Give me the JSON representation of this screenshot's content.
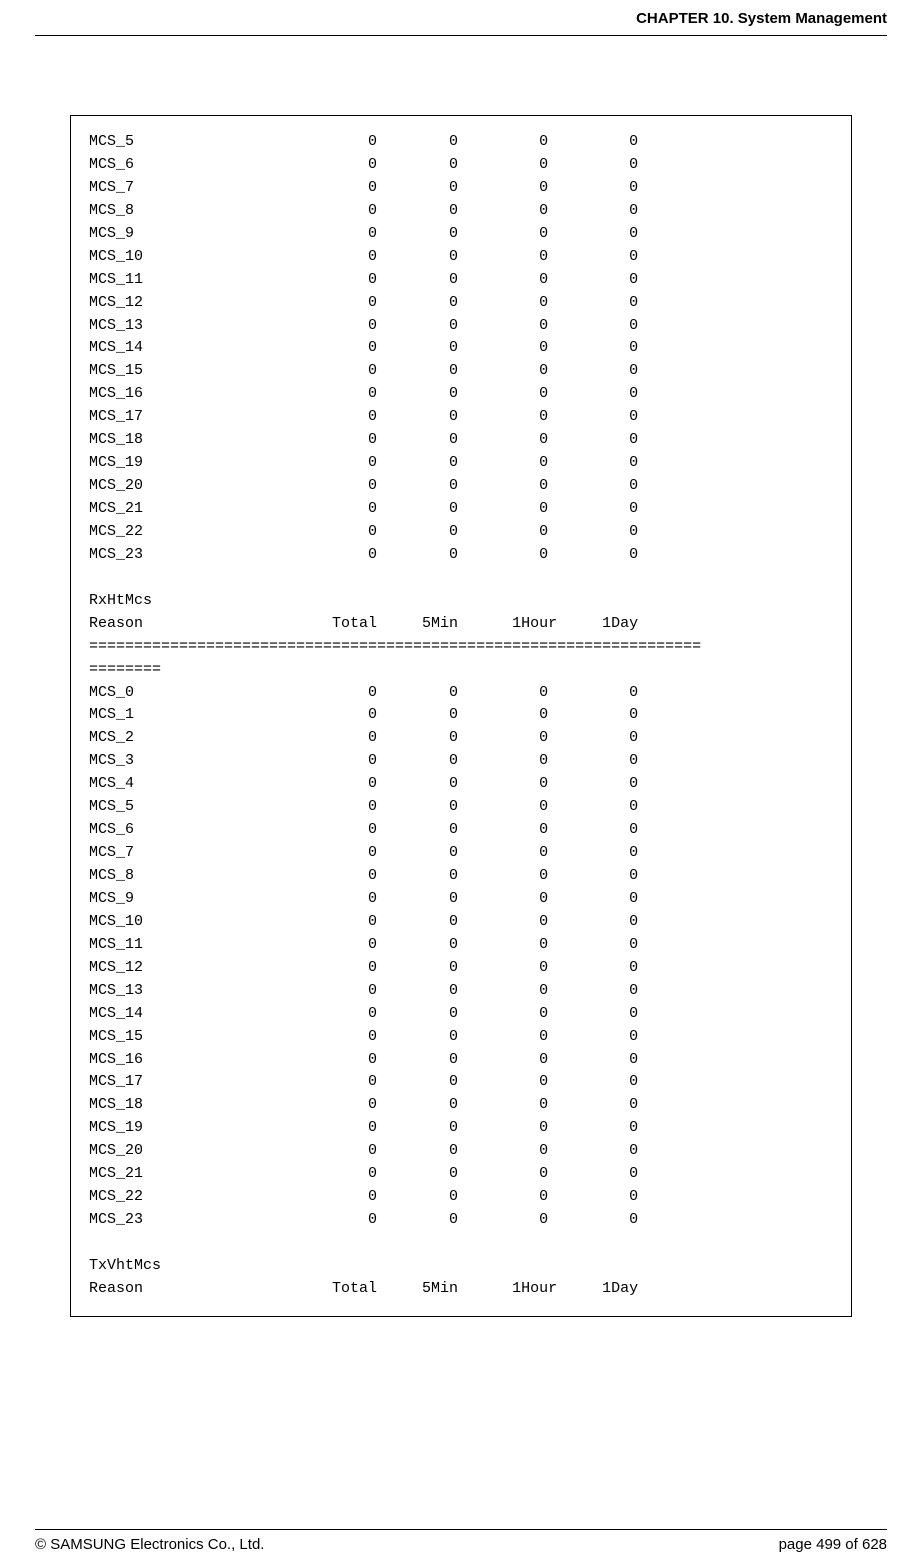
{
  "header": {
    "chapter": "CHAPTER 10. System Management"
  },
  "footer": {
    "copyright": "© SAMSUNG Electronics Co., Ltd.",
    "page": "page 499 of 628"
  },
  "section1": {
    "rows": [
      {
        "name": "MCS_5",
        "total": "0",
        "min5": "0",
        "hour1": "0",
        "day1": "0"
      },
      {
        "name": "MCS_6",
        "total": "0",
        "min5": "0",
        "hour1": "0",
        "day1": "0"
      },
      {
        "name": "MCS_7",
        "total": "0",
        "min5": "0",
        "hour1": "0",
        "day1": "0"
      },
      {
        "name": "MCS_8",
        "total": "0",
        "min5": "0",
        "hour1": "0",
        "day1": "0"
      },
      {
        "name": "MCS_9",
        "total": "0",
        "min5": "0",
        "hour1": "0",
        "day1": "0"
      },
      {
        "name": "MCS_10",
        "total": "0",
        "min5": "0",
        "hour1": "0",
        "day1": "0"
      },
      {
        "name": "MCS_11",
        "total": "0",
        "min5": "0",
        "hour1": "0",
        "day1": "0"
      },
      {
        "name": "MCS_12",
        "total": "0",
        "min5": "0",
        "hour1": "0",
        "day1": "0"
      },
      {
        "name": "MCS_13",
        "total": "0",
        "min5": "0",
        "hour1": "0",
        "day1": "0"
      },
      {
        "name": "MCS_14",
        "total": "0",
        "min5": "0",
        "hour1": "0",
        "day1": "0"
      },
      {
        "name": "MCS_15",
        "total": "0",
        "min5": "0",
        "hour1": "0",
        "day1": "0"
      },
      {
        "name": "MCS_16",
        "total": "0",
        "min5": "0",
        "hour1": "0",
        "day1": "0"
      },
      {
        "name": "MCS_17",
        "total": "0",
        "min5": "0",
        "hour1": "0",
        "day1": "0"
      },
      {
        "name": "MCS_18",
        "total": "0",
        "min5": "0",
        "hour1": "0",
        "day1": "0"
      },
      {
        "name": "MCS_19",
        "total": "0",
        "min5": "0",
        "hour1": "0",
        "day1": "0"
      },
      {
        "name": "MCS_20",
        "total": "0",
        "min5": "0",
        "hour1": "0",
        "day1": "0"
      },
      {
        "name": "MCS_21",
        "total": "0",
        "min5": "0",
        "hour1": "0",
        "day1": "0"
      },
      {
        "name": "MCS_22",
        "total": "0",
        "min5": "0",
        "hour1": "0",
        "day1": "0"
      },
      {
        "name": "MCS_23",
        "total": "0",
        "min5": "0",
        "hour1": "0",
        "day1": "0"
      }
    ]
  },
  "section2": {
    "title": "RxHtMcs",
    "headers": {
      "reason": "Reason",
      "total": "Total",
      "min5": "5Min",
      "hour1": "1Hour",
      "day1": "1Day"
    },
    "separator1": "====================================================================",
    "separator2": "========",
    "rows": [
      {
        "name": "MCS_0",
        "total": "0",
        "min5": "0",
        "hour1": "0",
        "day1": "0"
      },
      {
        "name": "MCS_1",
        "total": "0",
        "min5": "0",
        "hour1": "0",
        "day1": "0"
      },
      {
        "name": "MCS_2",
        "total": "0",
        "min5": "0",
        "hour1": "0",
        "day1": "0"
      },
      {
        "name": "MCS_3",
        "total": "0",
        "min5": "0",
        "hour1": "0",
        "day1": "0"
      },
      {
        "name": "MCS_4",
        "total": "0",
        "min5": "0",
        "hour1": "0",
        "day1": "0"
      },
      {
        "name": "MCS_5",
        "total": "0",
        "min5": "0",
        "hour1": "0",
        "day1": "0"
      },
      {
        "name": "MCS_6",
        "total": "0",
        "min5": "0",
        "hour1": "0",
        "day1": "0"
      },
      {
        "name": "MCS_7",
        "total": "0",
        "min5": "0",
        "hour1": "0",
        "day1": "0"
      },
      {
        "name": "MCS_8",
        "total": "0",
        "min5": "0",
        "hour1": "0",
        "day1": "0"
      },
      {
        "name": "MCS_9",
        "total": "0",
        "min5": "0",
        "hour1": "0",
        "day1": "0"
      },
      {
        "name": "MCS_10",
        "total": "0",
        "min5": "0",
        "hour1": "0",
        "day1": "0"
      },
      {
        "name": "MCS_11",
        "total": "0",
        "min5": "0",
        "hour1": "0",
        "day1": "0"
      },
      {
        "name": "MCS_12",
        "total": "0",
        "min5": "0",
        "hour1": "0",
        "day1": "0"
      },
      {
        "name": "MCS_13",
        "total": "0",
        "min5": "0",
        "hour1": "0",
        "day1": "0"
      },
      {
        "name": "MCS_14",
        "total": "0",
        "min5": "0",
        "hour1": "0",
        "day1": "0"
      },
      {
        "name": "MCS_15",
        "total": "0",
        "min5": "0",
        "hour1": "0",
        "day1": "0"
      },
      {
        "name": "MCS_16",
        "total": "0",
        "min5": "0",
        "hour1": "0",
        "day1": "0"
      },
      {
        "name": "MCS_17",
        "total": "0",
        "min5": "0",
        "hour1": "0",
        "day1": "0"
      },
      {
        "name": "MCS_18",
        "total": "0",
        "min5": "0",
        "hour1": "0",
        "day1": "0"
      },
      {
        "name": "MCS_19",
        "total": "0",
        "min5": "0",
        "hour1": "0",
        "day1": "0"
      },
      {
        "name": "MCS_20",
        "total": "0",
        "min5": "0",
        "hour1": "0",
        "day1": "0"
      },
      {
        "name": "MCS_21",
        "total": "0",
        "min5": "0",
        "hour1": "0",
        "day1": "0"
      },
      {
        "name": "MCS_22",
        "total": "0",
        "min5": "0",
        "hour1": "0",
        "day1": "0"
      },
      {
        "name": "MCS_23",
        "total": "0",
        "min5": "0",
        "hour1": "0",
        "day1": "0"
      }
    ]
  },
  "section3": {
    "title": "TxVhtMcs",
    "headers": {
      "reason": "Reason",
      "total": "Total",
      "min5": "5Min",
      "hour1": "1Hour",
      "day1": "1Day"
    }
  }
}
